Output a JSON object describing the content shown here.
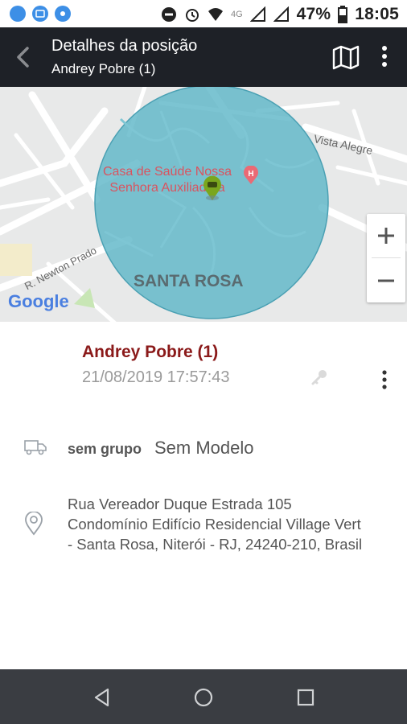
{
  "status_bar": {
    "network": "4G",
    "battery_percent": "47%",
    "time": "18:05"
  },
  "app_bar": {
    "title": "Detalhes da posição",
    "subtitle": "Andrey Pobre (1)"
  },
  "map": {
    "labels": {
      "street_top": "Vista Alegre",
      "poi": "Casa de Saúde Nossa\nSenhora Auxiliadora",
      "poi_line1": "Casa de Saúde Nossa",
      "poi_line2": "Senhora Auxiliadora",
      "street_left": "R. Newton Prado",
      "neighborhood": "SANTA ROSA",
      "logo": "Google"
    },
    "colors": {
      "circle_fill": "#5fb7c8",
      "poi_text": "#d9535f",
      "marker": "#7aa61e"
    },
    "zoom_in": "+",
    "zoom_out": "−"
  },
  "details": {
    "name": "Andrey Pobre (1)",
    "datetime": "21/08/2019 17:57:43",
    "group": "sem grupo",
    "model": "Sem Modelo",
    "address_line1": "Rua Vereador Duque Estrada 105",
    "address_line2": "Condomínio Edifício Residencial Village Vert",
    "address_line3": "- Santa Rosa, Niterói - RJ, 24240-210, Brasil"
  },
  "icons": {
    "back": "back-arrow-icon",
    "map": "map-icon",
    "more": "more-vert-icon",
    "key": "key-icon",
    "truck": "truck-icon",
    "pin": "location-pin-icon"
  }
}
